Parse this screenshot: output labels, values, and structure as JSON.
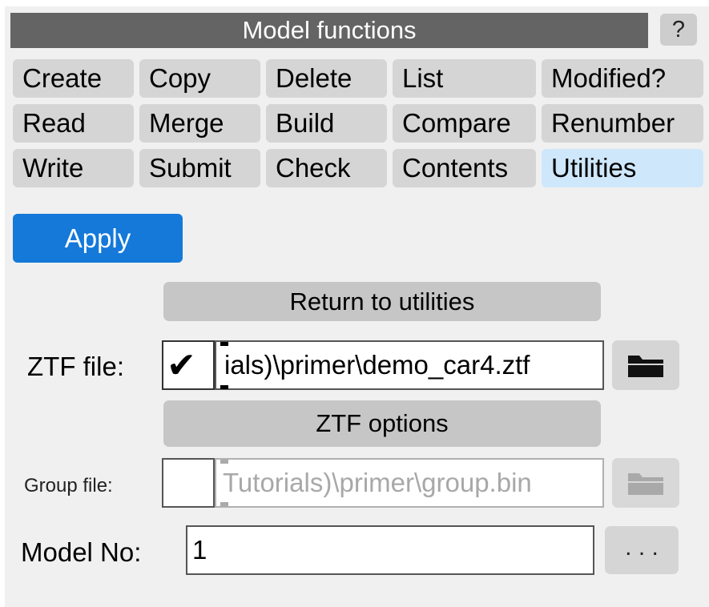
{
  "title": "Model functions",
  "help_label": "?",
  "function_buttons": [
    "Create",
    "Copy",
    "Delete",
    "List",
    "Modified?",
    "Read",
    "Merge",
    "Build",
    "Compare",
    "Renumber",
    "Write",
    "Submit",
    "Check",
    "Contents",
    "Utilities"
  ],
  "active_function": "Utilities",
  "apply_label": "Apply",
  "return_label": "Return to utilities",
  "ztf": {
    "label": "ZTF file:",
    "checked": true,
    "check_glyph": "✔",
    "value": "ials)\\primer\\demo_car4.ztf"
  },
  "ztf_options_label": "ZTF options",
  "group": {
    "label": "Group file:",
    "checked": false,
    "value": "Tutorials)\\primer\\group.bin"
  },
  "model": {
    "label": "Model No:",
    "value": "1",
    "dots_label": ". . ."
  },
  "colors": {
    "accent": "#1479d9",
    "active_tab": "#cfe7fb",
    "titlebar": "#646464"
  },
  "icons": [
    "folder-icon",
    "folder-icon-disabled",
    "check-icon"
  ]
}
